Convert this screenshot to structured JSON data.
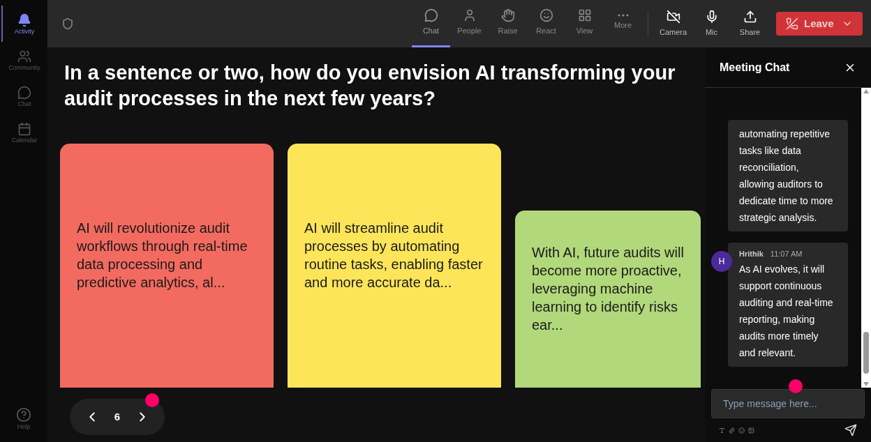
{
  "rail": [
    {
      "label": "Activity",
      "selected": true
    },
    {
      "label": "Community",
      "selected": false
    },
    {
      "label": "Chat",
      "selected": false
    },
    {
      "label": "Calendar",
      "selected": false
    }
  ],
  "help": {
    "label": "Help"
  },
  "toolbar": [
    {
      "label": "Chat",
      "selected": true
    },
    {
      "label": "People",
      "selected": false
    },
    {
      "label": "Raise",
      "selected": false
    },
    {
      "label": "React",
      "selected": false
    },
    {
      "label": "View",
      "selected": false
    },
    {
      "label": "More",
      "selected": false
    }
  ],
  "media": [
    {
      "label": "Camera"
    },
    {
      "label": "Mic"
    },
    {
      "label": "Share"
    }
  ],
  "leave": {
    "label": "Leave"
  },
  "question": "In a sentence or two, how do you envision AI transforming your audit processes in the next few years?",
  "cards": [
    {
      "text": "AI will revolutionize audit workflows through real-time data processing and predictive analytics, al...",
      "color": "#f36b60"
    },
    {
      "text": "AI will streamline audit processes by automating routine tasks, enabling faster and more accurate da...",
      "color": "#fde55a"
    },
    {
      "text": "With AI, future audits will become more proactive, leveraging machine learning to identify risks ear...",
      "color": "#b1d87b"
    }
  ],
  "pager": {
    "page": "6"
  },
  "chat": {
    "title": "Meeting Chat",
    "messages": [
      {
        "text": "automating repetitive tasks like data reconciliation, allowing auditors to dedicate time to more strategic analysis."
      },
      {
        "author": "Hrithik",
        "time": "11:07 AM",
        "avatar": "H",
        "text": "As AI evolves, it will support continuous auditing and real-time reporting, making audits more timely and relevant."
      }
    ],
    "input": {
      "placeholder": "Type message here..."
    }
  }
}
